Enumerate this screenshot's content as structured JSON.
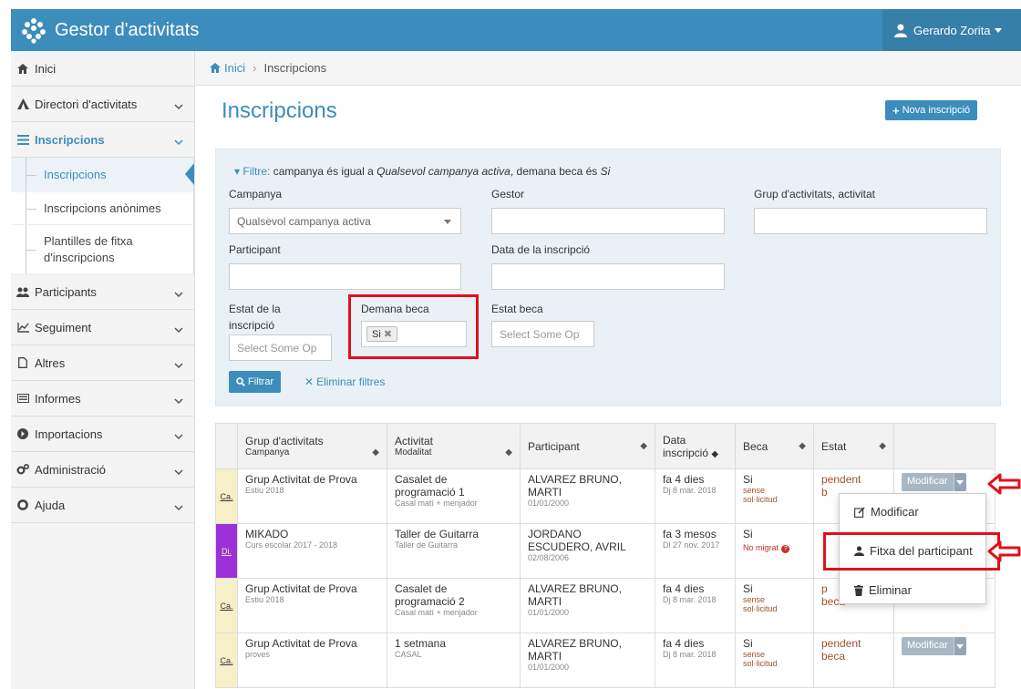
{
  "header": {
    "app_title": "Gestor d'activitats",
    "user_name": "Gerardo Zorita"
  },
  "sidebar": {
    "items": [
      {
        "label": "Inici"
      },
      {
        "label": "Directori d'activitats"
      },
      {
        "label": "Inscripcions"
      },
      {
        "label": "Participants"
      },
      {
        "label": "Seguiment"
      },
      {
        "label": "Altres"
      },
      {
        "label": "Informes"
      },
      {
        "label": "Importacions"
      },
      {
        "label": "Administració"
      },
      {
        "label": "Ajuda"
      }
    ],
    "sub_items": [
      {
        "label": "Inscripcions"
      },
      {
        "label": "Inscripcions anònimes"
      },
      {
        "label": "Plantilles de fitxa d'inscripcions"
      }
    ]
  },
  "breadcrumb": {
    "home": "Inici",
    "current": "Inscripcions"
  },
  "page": {
    "title": "Inscripcions",
    "new_button": "Nova inscripció"
  },
  "filter": {
    "summary_lead": "Filtre:",
    "summary_text1": " campanya és igual a ",
    "summary_em1": "Qualsevol campanya activa",
    "summary_text2": ", demana beca és ",
    "summary_em2": "Si",
    "campanya_label": "Campanya",
    "campanya_value": "Qualsevol campanya activa",
    "gestor_label": "Gestor",
    "grup_label": "Grup d'activitats, activitat",
    "participant_label": "Participant",
    "data_label": "Data de la inscripció",
    "estat_label_1": "Estat de la",
    "estat_label_2": "inscripció",
    "estat_placeholder": "Select Some Op",
    "beca_label": "Demana beca",
    "beca_tag": "Si",
    "estat_beca_label": "Estat beca",
    "estat_beca_placeholder": "Select Some Op",
    "filter_button": "Filtrar",
    "clear_button": "Eliminar filtres"
  },
  "table": {
    "headers": {
      "grup": "Grup d'activitats",
      "campanya": "Campanya",
      "activitat": "Activitat",
      "modalitat": "Modalitat",
      "participant": "Participant",
      "data_1": "Data",
      "data_2": "inscripció",
      "beca": "Beca",
      "estat": "Estat"
    },
    "rows": [
      {
        "camp": "Ca.",
        "camp_color": "#f5f0c8",
        "grup": "Grup Activitat de Prova",
        "campanya": "Estiu 2018",
        "act1": "Casalet de",
        "act2": "programació 1",
        "modalitat": "Casal matí + menjador",
        "part1": "ALVAREZ BRUNO,",
        "part2": "MARTI",
        "birth": "01/01/2000",
        "data": "fa 4 dies",
        "data_small": "Dj 8 mar. 2018",
        "beca": "Si",
        "beca_s1": "sense",
        "beca_s2": "sol·licitud",
        "estat1": "pendent",
        "estat2": "b",
        "action": "Modificar"
      },
      {
        "camp": "Di.",
        "camp_color": "#9b30d9",
        "grup": "MIKADO",
        "campanya": "Curs escolar 2017 - 2018",
        "act1": "Taller de Guitarra",
        "act2": "",
        "modalitat": "Taller de Guitarra",
        "part1": "JORDANO",
        "part2": "ESCUDERO, AVRIL",
        "birth": "02/08/2006",
        "data": "fa 3 mesos",
        "data_small": "Dl 27 nov. 2017",
        "beca": "Si",
        "beca_s1": "No migrat",
        "beca_s2": "",
        "estat1": "",
        "estat2": "",
        "action": ""
      },
      {
        "camp": "Ca.",
        "camp_color": "#f5f0c8",
        "grup": "Grup Activitat de Prova",
        "campanya": "Estiu 2018",
        "act1": "Casalet de",
        "act2": "programació 2",
        "modalitat": "Casal matí + menjador",
        "part1": "ALVAREZ BRUNO,",
        "part2": "MARTI",
        "birth": "01/01/2000",
        "data": "fa 4 dies",
        "data_small": "Dj 8 mar. 2018",
        "beca": "Si",
        "beca_s1": "sense",
        "beca_s2": "sol·licitud",
        "estat1": "p",
        "estat2": "beca",
        "action": ""
      },
      {
        "camp": "Ca.",
        "camp_color": "#f5f0c8",
        "grup": "Grup Activitat de Prova",
        "campanya": "proves",
        "act1": "1 setmana",
        "act2": "",
        "modalitat": "CASAL",
        "part1": "ALVAREZ BRUNO,",
        "part2": "MARTI",
        "birth": "01/01/2000",
        "data": "fa 4 dies",
        "data_small": "Dj 8 mar. 2018",
        "beca": "Si",
        "beca_s1": "sense",
        "beca_s2": "sol·licitud",
        "estat1": "pendent",
        "estat2": "beca",
        "action": "Modificar"
      }
    ]
  },
  "dropdown": {
    "modify": "Modificar",
    "participant_file": "Fitxa del participant",
    "delete": "Eliminar"
  },
  "colors": {
    "primary": "#3c8dbc",
    "annotation_red": "#e0101b"
  }
}
